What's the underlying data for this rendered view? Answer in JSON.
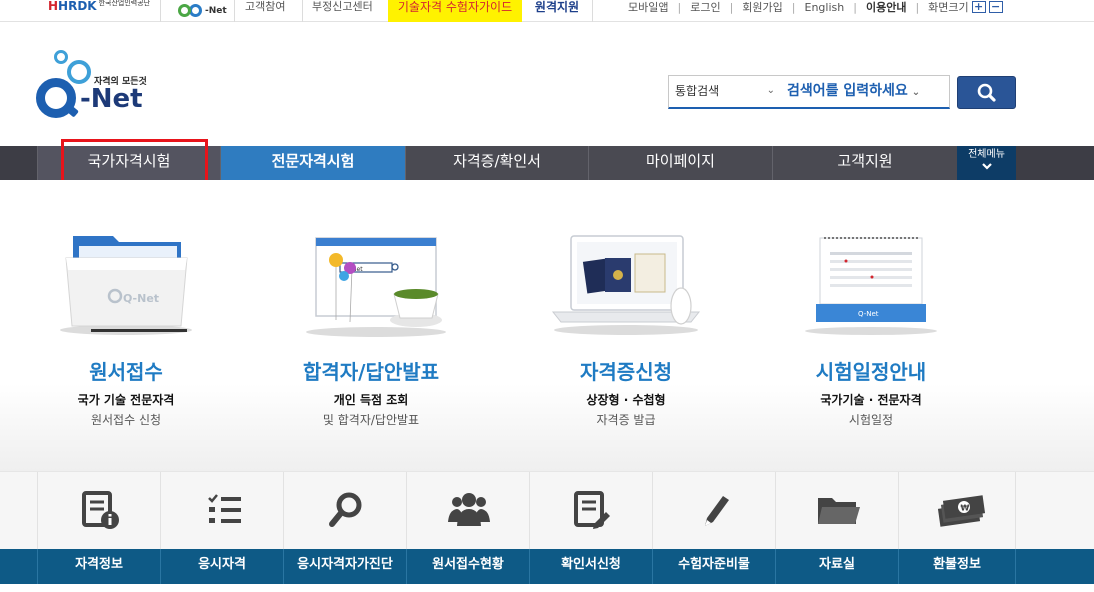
{
  "topbar": {
    "hrdk_logo": "HRDK",
    "hrdk_org": "한국산업인력공단",
    "cqnet_label": "-Net",
    "links": [
      "고객참여",
      "부정신고센터"
    ],
    "guide": "기술자격 수험자가이드",
    "remote": "원격지원",
    "right_links": [
      "모바일앱",
      "로그인",
      "회원가입",
      "English",
      "이용안내",
      "화면크기"
    ],
    "zoom_in": "+",
    "zoom_out": "−"
  },
  "logo": {
    "slogan": "자격의 모든것",
    "net": "-Net"
  },
  "search": {
    "scope": "통합검색",
    "keyword_placeholder": "검색어를 입력하세요",
    "chevron": "⌄"
  },
  "nav": {
    "items": [
      "국가자격시험",
      "전문자격시험",
      "자격증/확인서",
      "마이페이지",
      "고객지원"
    ],
    "all_menu": "전체메뉴"
  },
  "services": [
    {
      "name": "원서접수",
      "sub1": "국가 기술 전문자격",
      "sub2": "원서접수 신청"
    },
    {
      "name": "합격자/답안발표",
      "sub1": "개인 득점 조회",
      "sub2": "및 합격자/답안발표"
    },
    {
      "name": "자격증신청",
      "sub1": "상장형 · 수첩형",
      "sub2": "자격증 발급"
    },
    {
      "name": "시험일정안내",
      "sub1": "국가기술 · 전문자격",
      "sub2": "시험일정"
    }
  ],
  "illustration_texts": {
    "folder_logo": "Q-Net",
    "browser_search": "Q-Net",
    "calendar_logo": "Q-Net"
  },
  "quick_links": [
    "자격정보",
    "응시자격",
    "응시자격자가진단",
    "원서접수현황",
    "확인서신청",
    "수험자준비물",
    "자료실",
    "환불정보"
  ],
  "quick_icons": [
    "document-info-icon",
    "checklist-icon",
    "magnifier-icon",
    "people-icon",
    "document-pen-icon",
    "pencil-icon",
    "folder-icon",
    "money-icon"
  ],
  "colors": {
    "accent": "#2f7cc0",
    "nav_bg": "#4a4a52",
    "quick_bar": "#0e5a86",
    "highlight_box": "#e8141b",
    "guide_bg": "#fff200"
  }
}
